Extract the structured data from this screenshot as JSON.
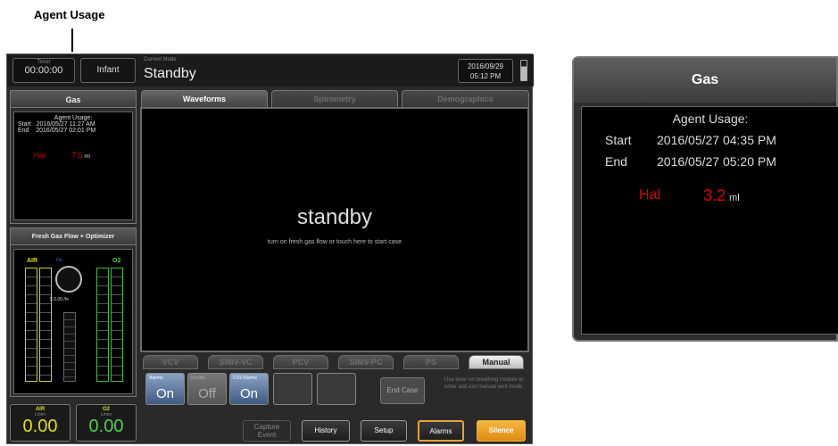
{
  "annotation": {
    "label": "Agent Usage"
  },
  "topbar": {
    "timer_label": "Timer",
    "timer_value": "00:00:00",
    "patient_button": "Infant",
    "mode_label": "Current Mode",
    "mode_value": "Standby",
    "date": "2016/09/29",
    "time": "05:12 PM"
  },
  "gas_panel": {
    "title": "Gas",
    "agent_usage": "Agent Usage:",
    "start_label": "Start",
    "start_value": "2016/05/27 11:27 AM",
    "end_label": "End",
    "end_value": "2016/05/27 02:01 PM",
    "agent": "Hal",
    "amount": "7.5",
    "unit": "ml"
  },
  "fresh_gas": {
    "title": "Fresh Gas Flow + Optimizer",
    "air_label": "AIR",
    "o2_label": "O2",
    "on_label": "On",
    "gauge_readout": "$ 0.00 /hr"
  },
  "flows": {
    "air_label": "AIR",
    "o2_label": "O2",
    "unit": "L/min",
    "air_value": "0.00",
    "o2_value": "0.00"
  },
  "tabs": [
    "Waveforms",
    "Spirometry",
    "Demographics"
  ],
  "waveform": {
    "headline": "standby",
    "subtext": "turn on fresh gas flow or touch here to start case"
  },
  "vent_modes": [
    "VCV",
    "SIMV-VC",
    "PCV",
    "SIMV-PC",
    "PS",
    "Manual"
  ],
  "controls": {
    "alarms_label": "Alarms",
    "alarms_value": "On",
    "monitor_label": "Monitor",
    "monitor_value": "Off",
    "co2_label": "CO2 Alarms",
    "co2_value": "On",
    "end_case": "End Case",
    "hint": "Use lever on breathing module to enter and exit manual vent mode"
  },
  "bottom_buttons": {
    "capture_line1": "Capture",
    "capture_line2": "Event",
    "history": "History",
    "setup": "Setup",
    "alarms": "Alarms",
    "silence": "Silence"
  },
  "zoom_panel": {
    "title": "Gas",
    "agent_usage": "Agent Usage:",
    "start_label": "Start",
    "start_value": "2016/05/27 04:35 PM",
    "end_label": "End",
    "end_value": "2016/05/27 05:20 PM",
    "agent": "Hal",
    "amount": "3.2",
    "unit": "ml"
  },
  "colors": {
    "agent_red": "#e00000",
    "air_yellow": "#e0e000",
    "o2_green": "#4ccf4c",
    "silence_orange": "#f0a020",
    "control_blue": "#4a6a96"
  }
}
